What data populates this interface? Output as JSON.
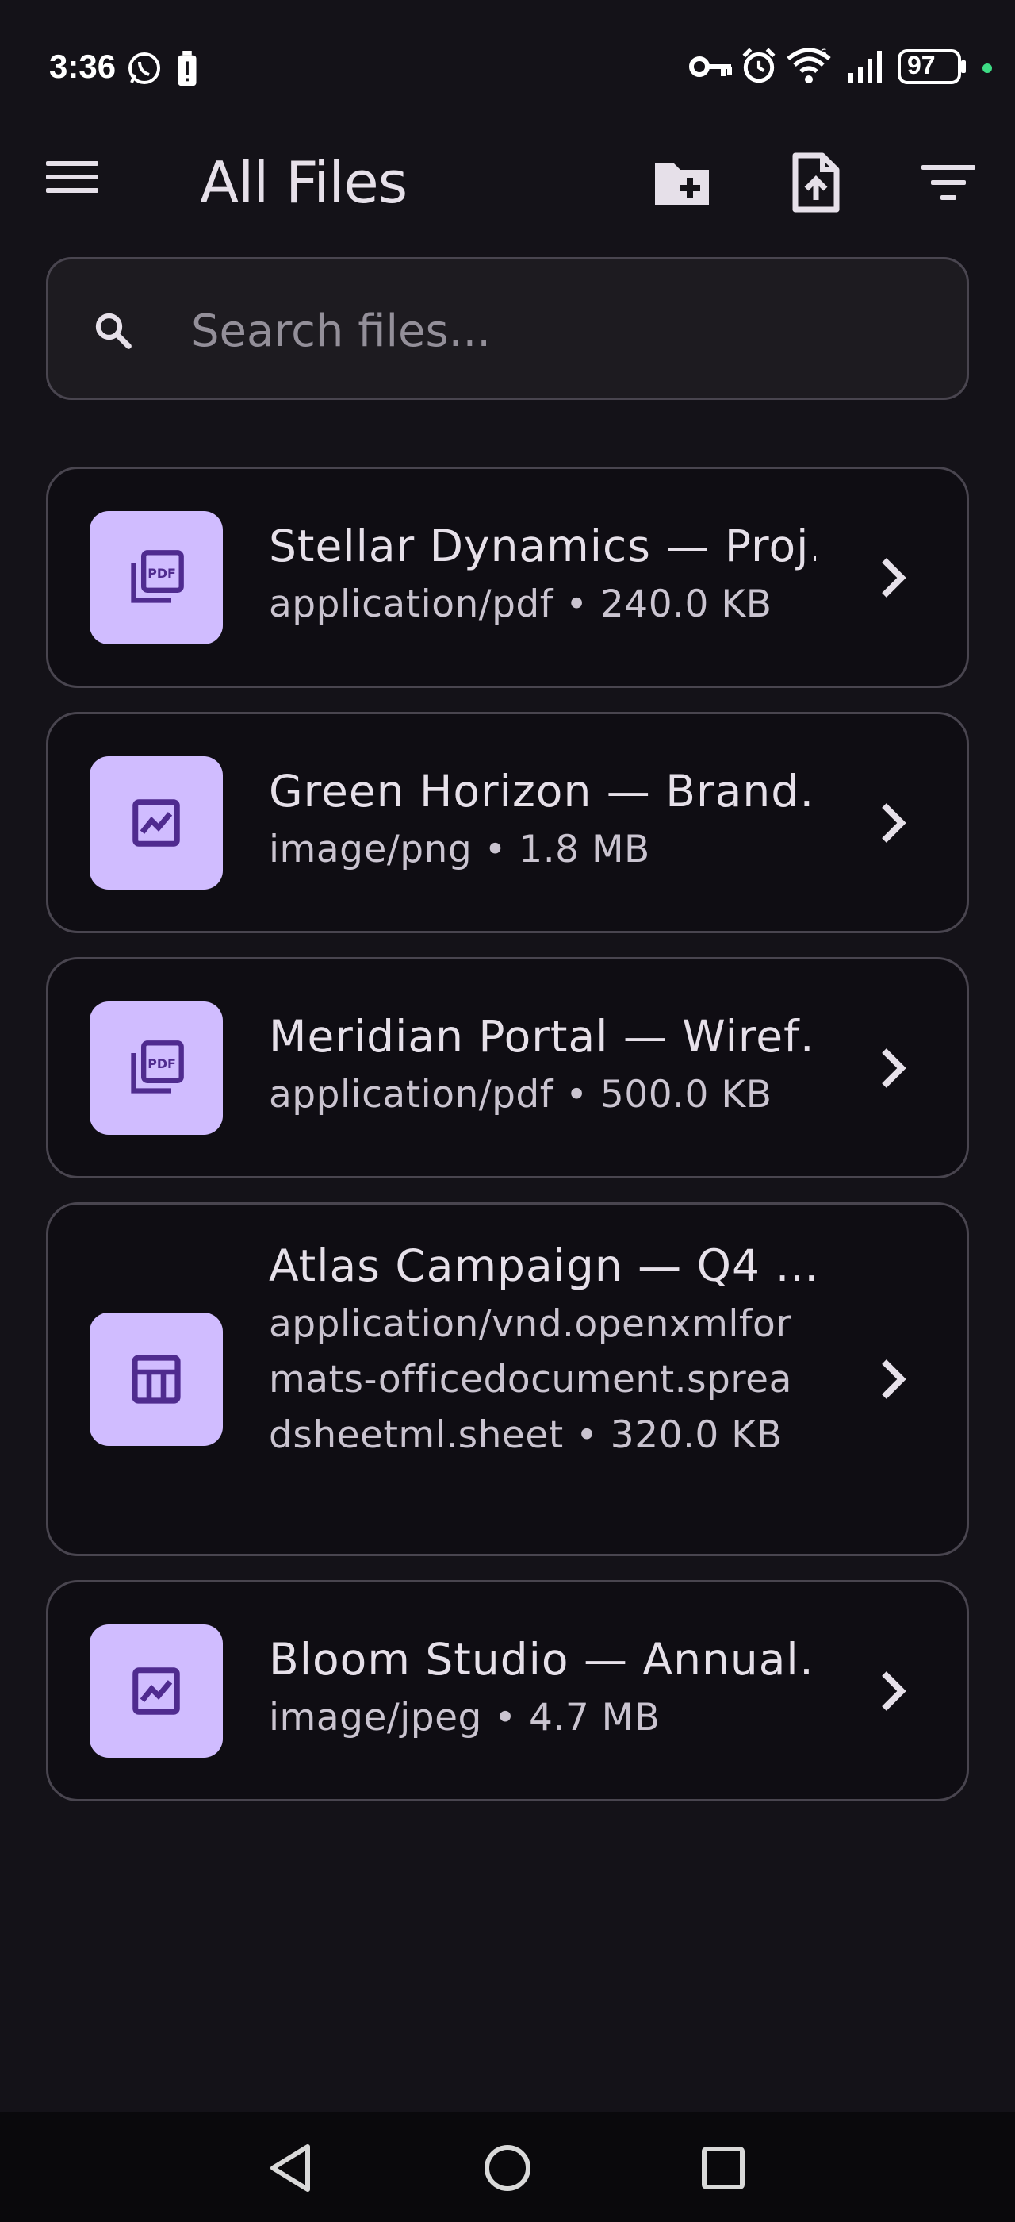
{
  "status_bar": {
    "time": "3:36",
    "battery": "97",
    "icons": [
      "whatsapp-icon",
      "battery-alert-icon",
      "vpn-key-icon",
      "alarm-icon",
      "wifi-6-icon",
      "signal-icon",
      "battery-icon",
      "privacy-dot-icon"
    ]
  },
  "app_bar": {
    "title": "All Files",
    "actions": [
      "create-folder-icon",
      "upload-file-icon",
      "filter-icon"
    ]
  },
  "search": {
    "placeholder": "Search files...",
    "value": ""
  },
  "files": [
    {
      "name": "Stellar Dynamics — Proj…",
      "meta": "application/pdf • 240.0 KB",
      "icon": "pdf-icon"
    },
    {
      "name": "Green Horizon — Brand…",
      "meta": "image/png • 1.8 MB",
      "icon": "image-icon"
    },
    {
      "name": "Meridian Portal — Wiref…",
      "meta": "application/pdf • 500.0 KB",
      "icon": "pdf-icon"
    },
    {
      "name": "Atlas Campaign — Q4 …",
      "meta": "application/vnd.openxmlformats-officedocument.spreadsheetml.sheet • 320.0 KB",
      "icon": "table-icon"
    },
    {
      "name": "Bloom Studio — Annual…",
      "meta": "image/jpeg • 4.7 MB",
      "icon": "image-icon"
    }
  ],
  "colors": {
    "background": "#141218",
    "card_border": "#49454f",
    "thumb": "#d0bcff",
    "thumb_icon": "#4f2b8f",
    "text": "#e6e0e9",
    "subtext": "#cac4d0"
  },
  "nav_bar": {
    "buttons": [
      "back-icon",
      "home-icon",
      "recents-icon"
    ]
  }
}
